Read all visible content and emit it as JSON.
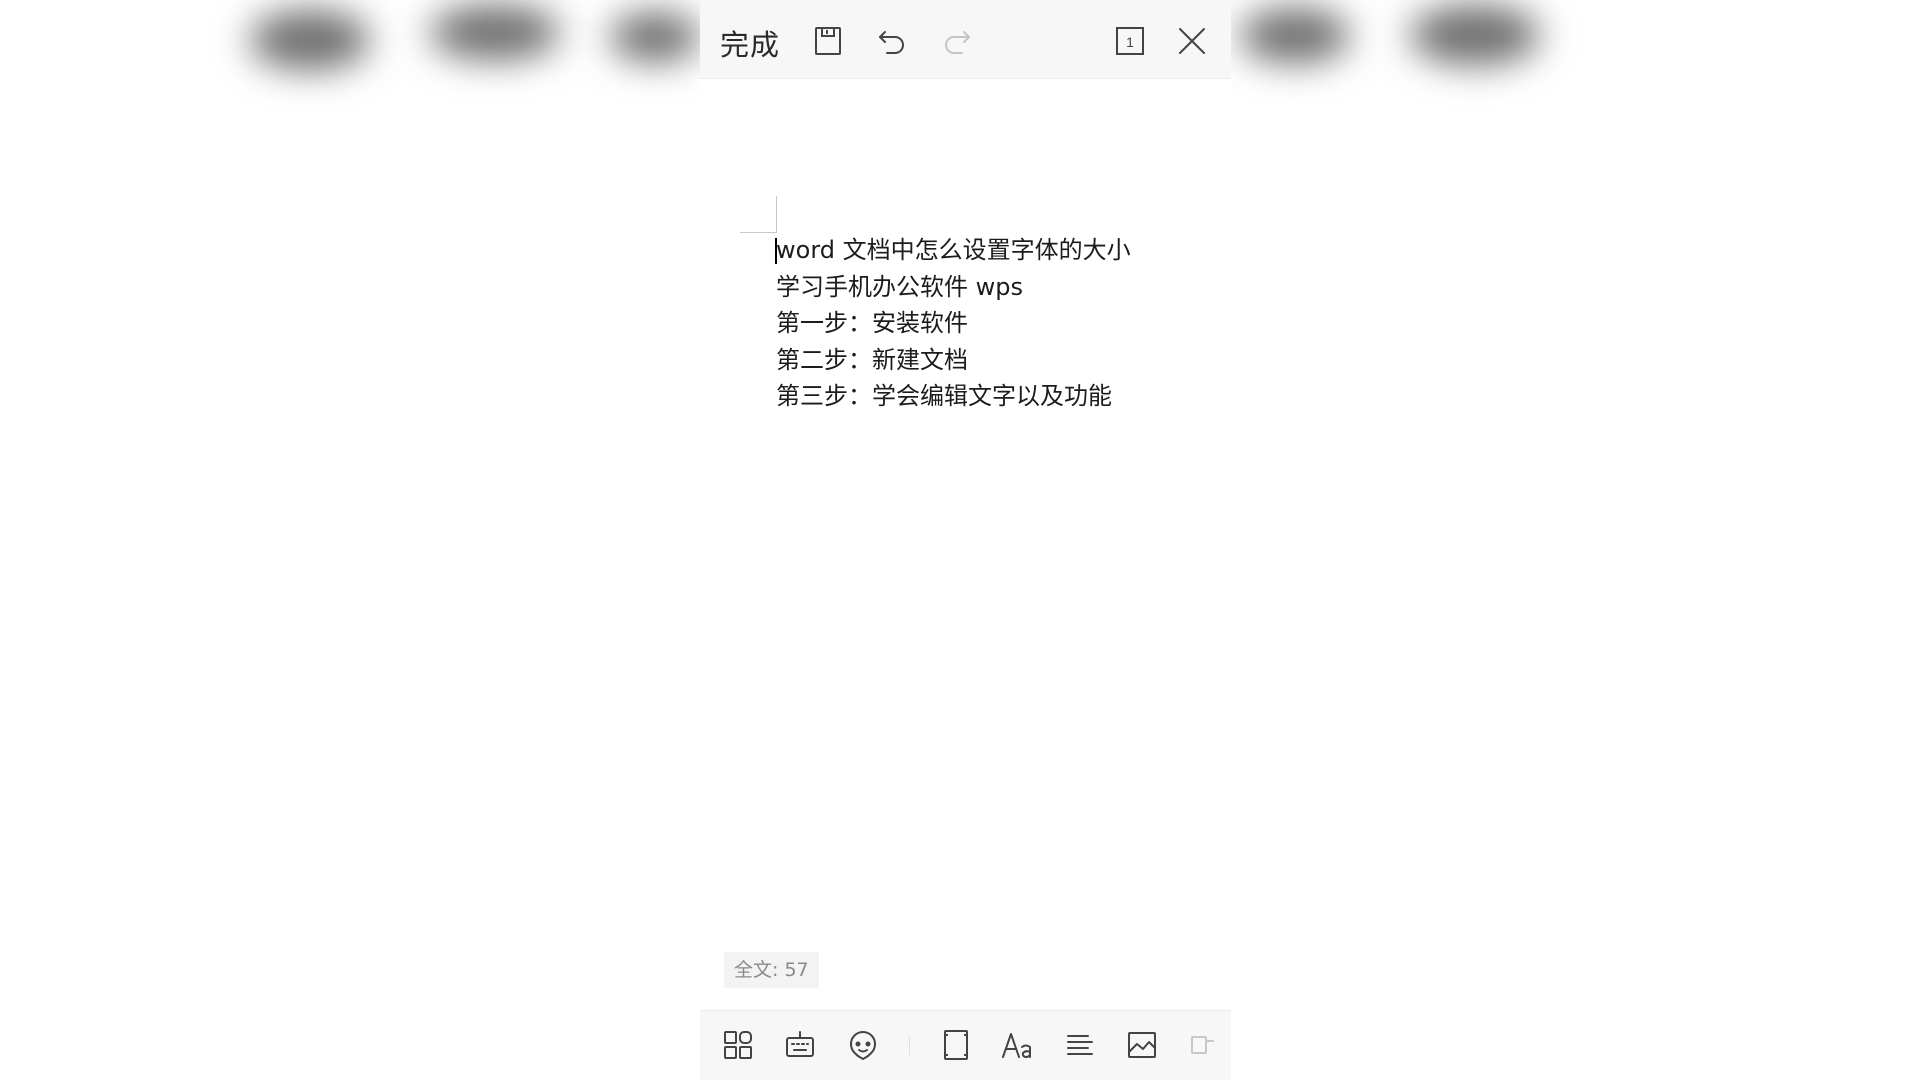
{
  "toolbar": {
    "done_label": "完成",
    "page_indicator": "1"
  },
  "document": {
    "lines": [
      "word 文档中怎么设置字体的大小",
      "学习手机办公软件 wps",
      "第一步：安装软件",
      "第二步：新建文档",
      "第三步：学会编辑文字以及功能"
    ]
  },
  "status": {
    "word_count": "全文: 57"
  },
  "icons": {
    "save": "save-icon",
    "undo": "undo-icon",
    "redo": "redo-icon",
    "page": "page-number-icon",
    "close": "close-icon",
    "apps": "apps-grid-icon",
    "keyboard": "keyboard-icon",
    "voice": "voice-assistant-icon",
    "page_frame": "page-frame-icon",
    "font": "font-icon",
    "align": "align-left-icon",
    "image": "insert-image-icon",
    "more": "more-icon"
  },
  "colors": {
    "toolbar_bg": "#f7f7f7",
    "text": "#1c1c1c",
    "icon": "#444444",
    "disabled_icon": "#c4c4c4"
  }
}
